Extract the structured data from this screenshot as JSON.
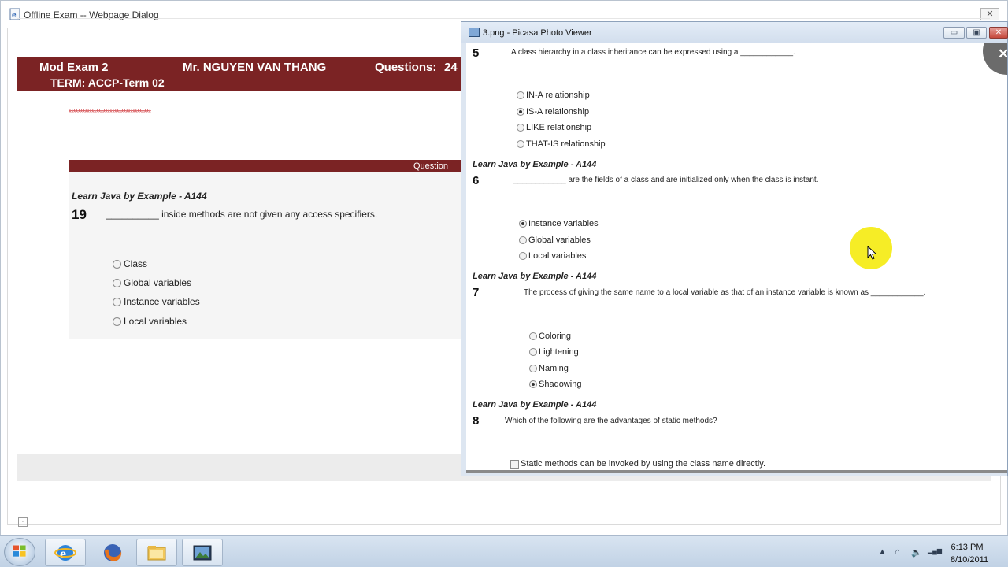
{
  "exam_window": {
    "title": "Offline Exam -- Webpage Dialog",
    "close_label": "✕",
    "header": {
      "mod_exam": "Mod Exam 2",
      "teacher": "Mr. NGUYEN VAN THANG",
      "questions_label": "Questions:",
      "questions_count": "24",
      "term": "TERM: ACCP-Term 02"
    },
    "stars": "************************************",
    "question_bar_label": "Question",
    "question": {
      "source": "Learn Java by Example - A144",
      "number": "19",
      "text": "__________ inside methods are not given any access specifiers.",
      "options": [
        "Class",
        "Global variables",
        "Instance variables",
        "Local variables"
      ]
    }
  },
  "picasa_window": {
    "title": "3.png - Picasa Photo Viewer",
    "min_label": "▭",
    "max_label": "▣",
    "close_label": "✕",
    "viewer_close_label": "✕",
    "questions": [
      {
        "number": "5",
        "text": "A class hierarchy in a class inheritance can be expressed using a ____________.",
        "options": [
          "IN-A relationship",
          "IS-A relationship",
          "LIKE relationship",
          "THAT-IS relationship"
        ],
        "selected": 1
      },
      {
        "source": "Learn Java by Example - A144",
        "number": "6",
        "text": "____________ are the fields of a class and are initialized only when the class is instant.",
        "options": [
          "Instance variables",
          "Global variables",
          "Local variables"
        ],
        "selected": 0
      },
      {
        "source": "Learn Java by Example - A144",
        "number": "7",
        "text": "The process of giving the same name to a local variable as that of an instance variable is known as ____________.",
        "options": [
          "Coloring",
          "Lightening",
          "Naming",
          "Shadowing"
        ],
        "selected": 3
      },
      {
        "source": "Learn Java by Example - A144",
        "number": "8",
        "text": "Which of the following are the advantages of static methods?",
        "options": [
          "Static methods can be invoked by using the class name directly."
        ]
      }
    ]
  },
  "taskbar": {
    "time": "6:13 PM",
    "date": "8/10/2011",
    "tray_icons": [
      "show-hidden-icon",
      "network-icon",
      "speaker-icon",
      "signal-icon"
    ],
    "tray_glyphs": [
      "▲",
      "⌂",
      "🔈",
      "▂▄▆"
    ]
  }
}
